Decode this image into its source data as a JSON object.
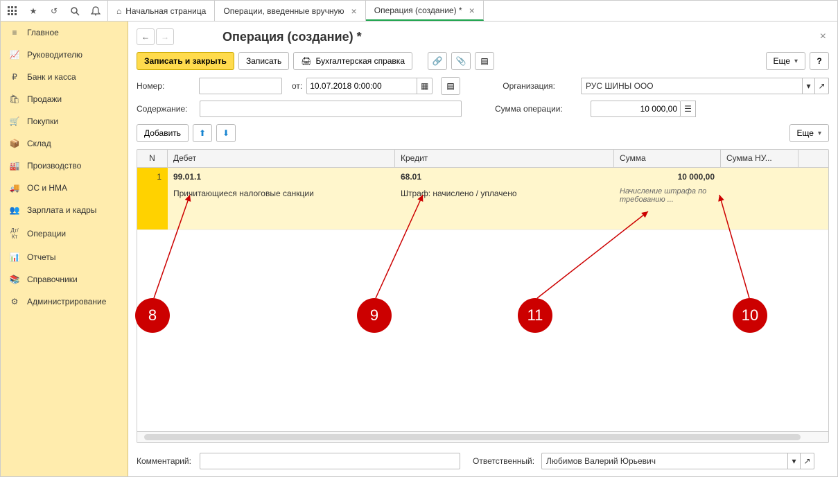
{
  "toolbar_icons": [
    "apps-icon",
    "star-icon",
    "history-icon",
    "search-icon",
    "bell-icon"
  ],
  "tabs": [
    {
      "label": "Начальная страница",
      "home": true,
      "closable": false,
      "active": false
    },
    {
      "label": "Операции, введенные вручную",
      "home": false,
      "closable": true,
      "active": false
    },
    {
      "label": "Операция (создание) *",
      "home": false,
      "closable": true,
      "active": true
    }
  ],
  "sidebar": [
    {
      "icon": "≡",
      "label": "Главное"
    },
    {
      "icon": "📈",
      "label": "Руководителю"
    },
    {
      "icon": "₽",
      "label": "Банк и касса"
    },
    {
      "icon": "🛍",
      "label": "Продажи"
    },
    {
      "icon": "🛒",
      "label": "Покупки"
    },
    {
      "icon": "📦",
      "label": "Склад"
    },
    {
      "icon": "🏭",
      "label": "Производство"
    },
    {
      "icon": "🚚",
      "label": "ОС и НМА"
    },
    {
      "icon": "👥",
      "label": "Зарплата и кадры"
    },
    {
      "icon": "Дт/Кт",
      "label": "Операции"
    },
    {
      "icon": "📊",
      "label": "Отчеты"
    },
    {
      "icon": "📚",
      "label": "Справочники"
    },
    {
      "icon": "⚙",
      "label": "Администрирование"
    }
  ],
  "page": {
    "title": "Операция (создание) *",
    "save_close": "Записать и закрыть",
    "save": "Записать",
    "accounting_ref": "Бухгалтерская справка",
    "more": "Еще",
    "help": "?"
  },
  "form": {
    "number_label": "Номер:",
    "number_value": "",
    "from_label": "от:",
    "date_value": "10.07.2018 0:00:00",
    "org_label": "Организация:",
    "org_value": "РУС ШИНЫ ООО",
    "content_label": "Содержание:",
    "content_value": "",
    "sumop_label": "Сумма операции:",
    "sumop_value": "10 000,00"
  },
  "table": {
    "add": "Добавить",
    "more": "Еще",
    "headers": {
      "n": "N",
      "debet": "Дебет",
      "kredit": "Кредит",
      "summa": "Сумма",
      "summa_nu": "Сумма НУ..."
    },
    "rows": [
      {
        "n": "1",
        "debet_acc": "99.01.1",
        "debet_desc": "Причитающиеся налоговые санкции",
        "kredit_acc": "68.01",
        "kredit_desc": "Штраф: начислено / уплачено",
        "summa": "10 000,00",
        "summa_desc": "Начисление штрафа по требованию ..."
      }
    ]
  },
  "footer": {
    "comment_label": "Комментарий:",
    "comment_value": "",
    "responsible_label": "Ответственный:",
    "responsible_value": "Любимов Валерий Юрьевич"
  },
  "callouts": {
    "c8": "8",
    "c9": "9",
    "c10": "10",
    "c11": "11"
  }
}
